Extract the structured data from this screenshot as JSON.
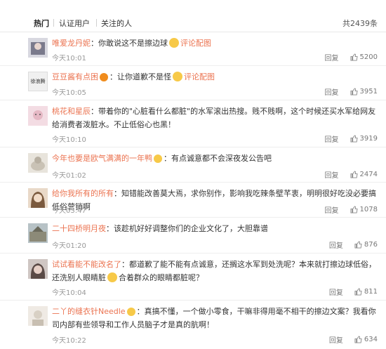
{
  "tabs": {
    "hot": "热门",
    "verified": "认证用户",
    "following": "关注的人",
    "total": "共2439条"
  },
  "comments": [
    {
      "user": "唯爱龙丹妮",
      "text": "：你敢说这不是擦边球",
      "link": "评论配图",
      "time": "今天10:01",
      "reply": "回复",
      "likes": "5200",
      "avatar_color": "#7a7a8c"
    },
    {
      "user": "豆豆酱有点困",
      "text": "：让你道歉不是怪",
      "link": "评论配图",
      "time": "今天10:05",
      "reply": "回复",
      "likes": "3951",
      "avatar_text": "徐浪腾",
      "avatar_color": "#f0f0f0"
    },
    {
      "user": "桃花和星辰",
      "text": "：带着你的\"心脏看什么都脏\"的水军滚出热搜。贱不贱啊，这个时候还买水军给网友给消费者泼脏水。不止低俗心也黑！",
      "time": "今天10:10",
      "reply": "回复",
      "likes": "3919",
      "avatar_color": "#e5b8c4"
    },
    {
      "user": "今年也要是欧气满满的一年鸭",
      "text": "：有点诚意都不会深夜发公告吧",
      "time": "今天01:02",
      "reply": "回复",
      "likes": "2474",
      "avatar_color": "#c9c2b5"
    },
    {
      "user": "给你我所有的所有",
      "text": "：知错能改善莫大焉，求你别作，影响我吃辣条壁芊衷，明明很好吃没必要搞低俗营销啊",
      "time": "今天03:47",
      "reply": "回复",
      "likes": "1078",
      "avatar_color": "#7b5a3e"
    },
    {
      "user": "二十四桥明月夜",
      "text": "：该趁机好好调整你们的企业文化了，大胆靠谱",
      "time": "今天01:20",
      "reply": "回复",
      "likes": "876",
      "avatar_color": "#8c8a78"
    },
    {
      "user": "试试看能不能改名了",
      "text": "：都道歉了能不能有点诚意，还搁这水军到处洗呢？本来就打擦边球低俗，还洗别人眼睛脏",
      "text2": "合着群众的眼睛都脏呢？",
      "time": "今天10:04",
      "reply": "回复",
      "likes": "811",
      "avatar_color": "#5a4a46"
    },
    {
      "user": "二丫的缝衣针Needle",
      "text": "：真搞不懂，一个做小零食，干嘛非得用毫不相干的擦边文案？我看你司内部有些领导和工作人员脑子才是真的肮啊！",
      "time": "今天10:22",
      "reply": "回复",
      "likes": "634",
      "avatar_color": "#d8d0c4"
    }
  ],
  "colors": {
    "username": "#eb7350",
    "time": "#999999",
    "emoji": "#f7c948"
  }
}
